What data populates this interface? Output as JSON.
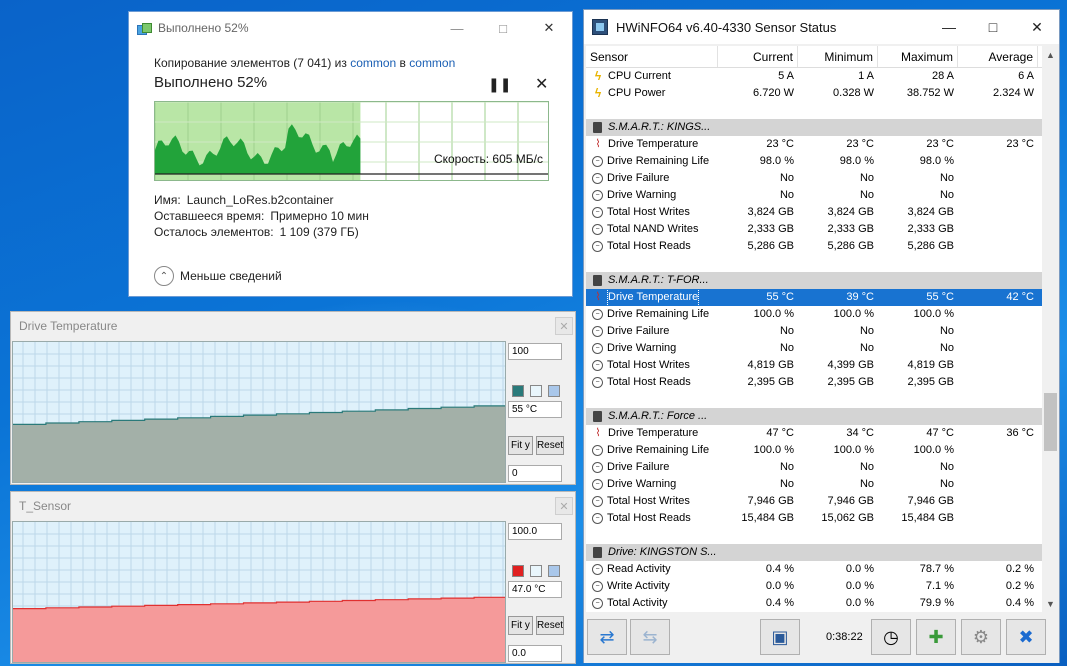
{
  "copy_dialog": {
    "title": "Выполнено 52%",
    "line_prefix": "Копирование элементов (7 041) из ",
    "source": "common",
    "line_mid": " в ",
    "dest": "common",
    "heading": "Выполнено 52%",
    "pause_icon": "pause-icon",
    "cancel_icon": "close-icon",
    "progress_percent": 52,
    "speed": "Скорость: 605 МБ/с",
    "name_label": "Имя:",
    "name_value": "Launch_LoRes.b2container",
    "time_label": "Оставшееся время:",
    "time_value": "Примерно 10 мин",
    "items_label": "Осталось элементов:",
    "items_value": "1 109 (379 ГБ)",
    "less_details": "Меньше сведений"
  },
  "graph_drive_temp": {
    "title": "Drive Temperature",
    "max": "100",
    "current": "55 °C",
    "min": "0",
    "fit": "Fit y",
    "reset": "Reset",
    "fill_color": "#a3b0a8",
    "line_color": "#2a7a7a"
  },
  "graph_t_sensor": {
    "title": "T_Sensor",
    "max": "100.0",
    "current": "47.0 °C",
    "min": "0.0",
    "fit": "Fit y",
    "reset": "Reset",
    "fill_color": "#f59a9a",
    "line_color": "#e03030"
  },
  "hwinfo": {
    "title": "HWiNFO64 v6.40-4330 Sensor Status",
    "columns": [
      "Sensor",
      "Current",
      "Minimum",
      "Maximum",
      "Average"
    ],
    "rows": [
      {
        "icon": "bolt",
        "name": "CPU Current",
        "cur": "5 A",
        "min": "1 A",
        "max": "28 A",
        "avg": "6 A"
      },
      {
        "icon": "bolt",
        "name": "CPU Power",
        "cur": "6.720 W",
        "min": "0.328 W",
        "max": "38.752 W",
        "avg": "2.324 W"
      },
      {
        "type": "gap"
      },
      {
        "type": "group",
        "name": "S.M.A.R.T.: KINGS..."
      },
      {
        "icon": "therm",
        "name": "Drive Temperature",
        "cur": "23 °C",
        "min": "23 °C",
        "max": "23 °C",
        "avg": "23 °C"
      },
      {
        "icon": "circ",
        "name": "Drive Remaining Life",
        "cur": "98.0 %",
        "min": "98.0 %",
        "max": "98.0 %",
        "avg": ""
      },
      {
        "icon": "circ",
        "name": "Drive Failure",
        "cur": "No",
        "min": "No",
        "max": "No",
        "avg": ""
      },
      {
        "icon": "circ",
        "name": "Drive Warning",
        "cur": "No",
        "min": "No",
        "max": "No",
        "avg": ""
      },
      {
        "icon": "circ",
        "name": "Total Host Writes",
        "cur": "3,824 GB",
        "min": "3,824 GB",
        "max": "3,824 GB",
        "avg": ""
      },
      {
        "icon": "circ",
        "name": "Total NAND Writes",
        "cur": "2,333 GB",
        "min": "2,333 GB",
        "max": "2,333 GB",
        "avg": ""
      },
      {
        "icon": "circ",
        "name": "Total Host Reads",
        "cur": "5,286 GB",
        "min": "5,286 GB",
        "max": "5,286 GB",
        "avg": ""
      },
      {
        "type": "gap"
      },
      {
        "type": "group",
        "name": "S.M.A.R.T.: T-FOR..."
      },
      {
        "icon": "therm",
        "name": "Drive Temperature",
        "cur": "55 °C",
        "min": "39 °C",
        "max": "55 °C",
        "avg": "42 °C",
        "selected": true
      },
      {
        "icon": "circ",
        "name": "Drive Remaining Life",
        "cur": "100.0 %",
        "min": "100.0 %",
        "max": "100.0 %",
        "avg": ""
      },
      {
        "icon": "circ",
        "name": "Drive Failure",
        "cur": "No",
        "min": "No",
        "max": "No",
        "avg": ""
      },
      {
        "icon": "circ",
        "name": "Drive Warning",
        "cur": "No",
        "min": "No",
        "max": "No",
        "avg": ""
      },
      {
        "icon": "circ",
        "name": "Total Host Writes",
        "cur": "4,819 GB",
        "min": "4,399 GB",
        "max": "4,819 GB",
        "avg": ""
      },
      {
        "icon": "circ",
        "name": "Total Host Reads",
        "cur": "2,395 GB",
        "min": "2,395 GB",
        "max": "2,395 GB",
        "avg": ""
      },
      {
        "type": "gap"
      },
      {
        "type": "group",
        "name": "S.M.A.R.T.: Force ..."
      },
      {
        "icon": "therm",
        "name": "Drive Temperature",
        "cur": "47 °C",
        "min": "34 °C",
        "max": "47 °C",
        "avg": "36 °C"
      },
      {
        "icon": "circ",
        "name": "Drive Remaining Life",
        "cur": "100.0 %",
        "min": "100.0 %",
        "max": "100.0 %",
        "avg": ""
      },
      {
        "icon": "circ",
        "name": "Drive Failure",
        "cur": "No",
        "min": "No",
        "max": "No",
        "avg": ""
      },
      {
        "icon": "circ",
        "name": "Drive Warning",
        "cur": "No",
        "min": "No",
        "max": "No",
        "avg": ""
      },
      {
        "icon": "circ",
        "name": "Total Host Writes",
        "cur": "7,946 GB",
        "min": "7,946 GB",
        "max": "7,946 GB",
        "avg": ""
      },
      {
        "icon": "circ",
        "name": "Total Host Reads",
        "cur": "15,484 GB",
        "min": "15,062 GB",
        "max": "15,484 GB",
        "avg": ""
      },
      {
        "type": "gap"
      },
      {
        "type": "group",
        "name": "Drive: KINGSTON S..."
      },
      {
        "icon": "circ",
        "name": "Read Activity",
        "cur": "0.4 %",
        "min": "0.0 %",
        "max": "78.7 %",
        "avg": "0.2 %"
      },
      {
        "icon": "circ",
        "name": "Write Activity",
        "cur": "0.0 %",
        "min": "0.0 %",
        "max": "7.1 %",
        "avg": "0.2 %"
      },
      {
        "icon": "circ",
        "name": "Total Activity",
        "cur": "0.4 %",
        "min": "0.0 %",
        "max": "79.9 %",
        "avg": "0.4 %"
      }
    ],
    "timer": "0:38:22"
  }
}
